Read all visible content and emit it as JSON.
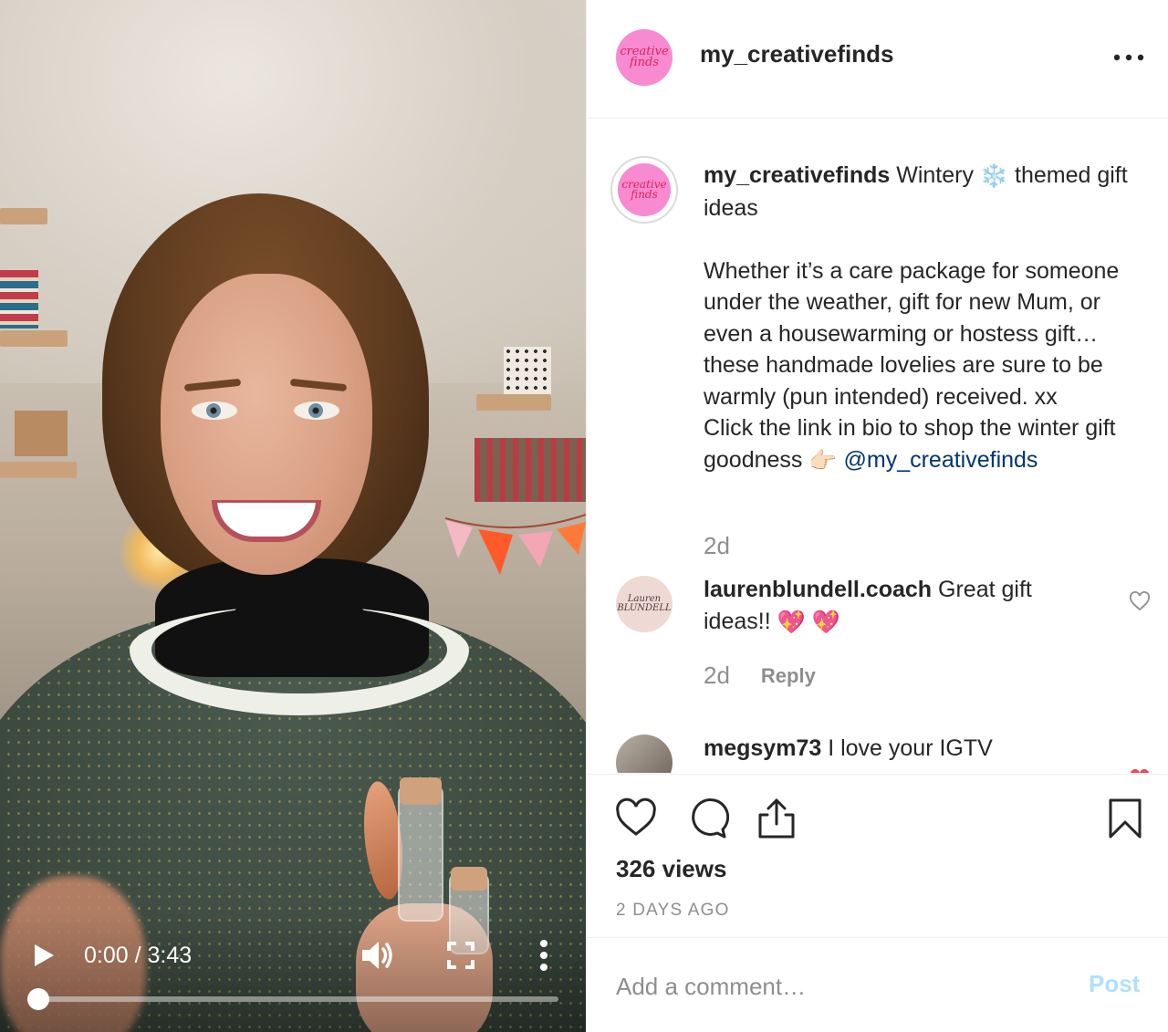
{
  "video": {
    "time": "0:00 / 3:43",
    "progress": 0.0
  },
  "header": {
    "username": "my_creativefinds",
    "avatar_text": "creative finds"
  },
  "caption": {
    "username": "my_creativefinds",
    "title": "Wintery",
    "title_rest": "themed gift ideas",
    "paragraph": "Whether it’s a care package for someone under the weather, gift for new Mum, or even a housewarming or hostess gift…these handmade lovelies are sure to be warmly (pun intended) received. xx",
    "cta": "Click the link in bio to shop the winter gift goodness",
    "mention": "@my_creativefinds",
    "age": "2d",
    "emoji_snowflake": "❄️",
    "emoji_point": "👉🏻"
  },
  "comments": [
    {
      "username": "laurenblundell.coach",
      "text": "Great gift ideas!!",
      "emojis": "💖 💖",
      "age": "2d",
      "reply_label": "Reply",
      "avatar_text": "Lauren BLUNDELL"
    },
    {
      "username": "megsym73",
      "text": "I love your IGTV"
    }
  ],
  "stats": {
    "views": "326 views",
    "posted": "2 DAYS AGO"
  },
  "composer": {
    "placeholder": "Add a comment…",
    "post_label": "Post"
  },
  "colors": {
    "avatar_pink": "#f78ad0",
    "link_blue": "#00376b",
    "post_disabled": "#b2dffc",
    "like_red": "#ed4956"
  },
  "icons": [
    "play-icon",
    "volume-icon",
    "fullscreen-icon",
    "more-vertical-icon",
    "more-horizontal-icon",
    "heart-icon",
    "comment-icon",
    "share-icon",
    "bookmark-icon"
  ]
}
